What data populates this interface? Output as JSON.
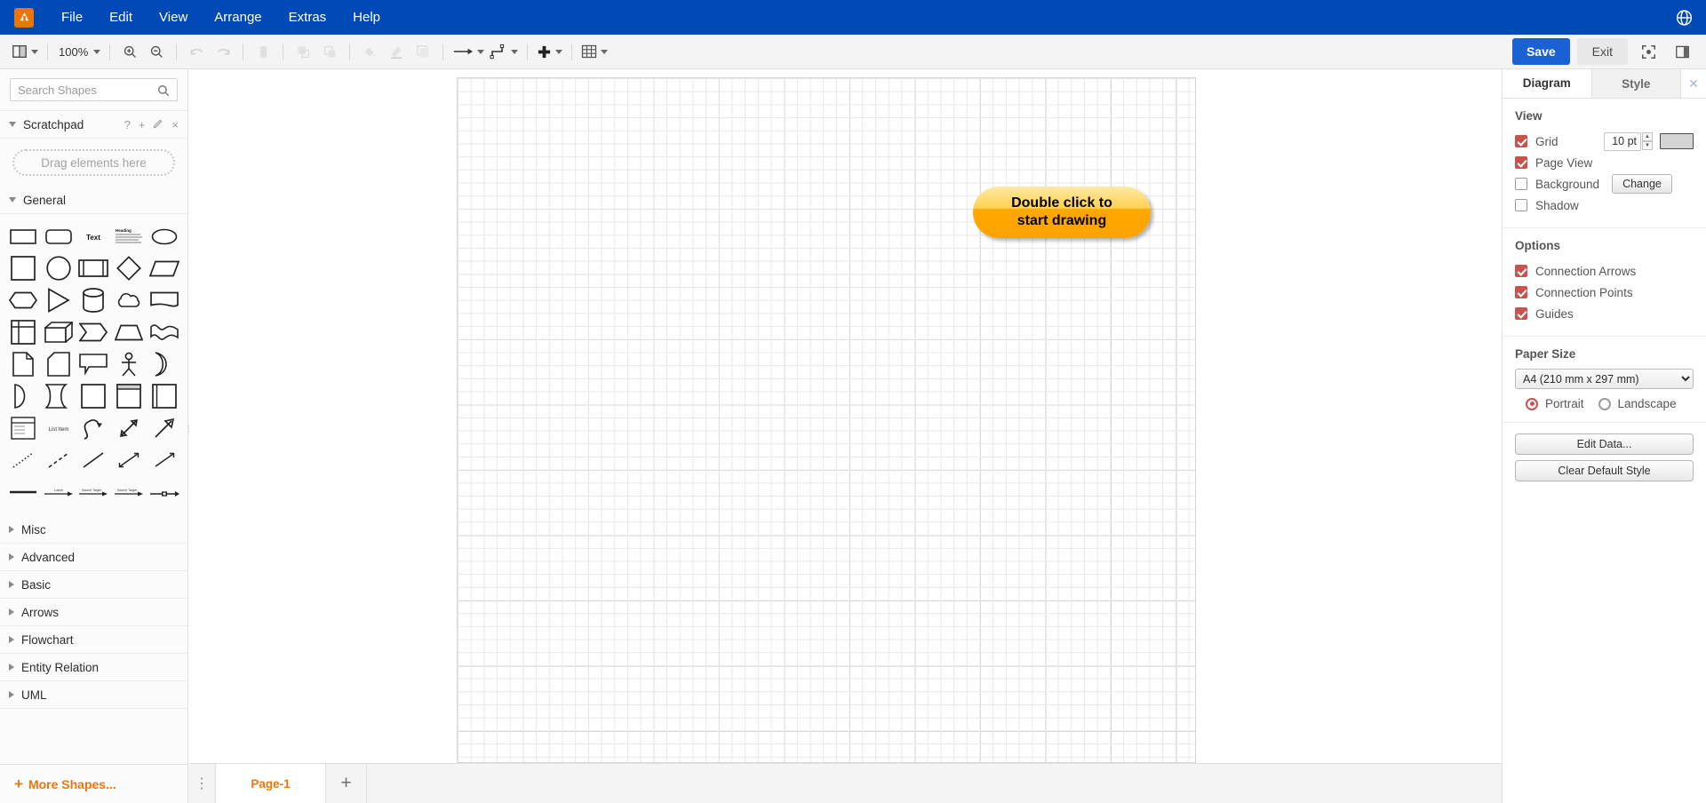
{
  "menubar": {
    "logo_icon": "drawio-logo-icon",
    "items": [
      "File",
      "Edit",
      "View",
      "Arrange",
      "Extras",
      "Help"
    ],
    "language_icon": "globe-icon"
  },
  "toolbar": {
    "view_icon": "panel-layout-icon",
    "zoom_label": "100%",
    "zoom_in_icon": "zoom-in-icon",
    "zoom_out_icon": "zoom-out-icon",
    "undo_icon": "undo-icon",
    "redo_icon": "redo-icon",
    "delete_icon": "trash-icon",
    "to_front_icon": "bring-to-front-icon",
    "to_back_icon": "send-to-back-icon",
    "fill_icon": "fill-color-icon",
    "line_icon": "line-color-icon",
    "shadow_icon": "shadow-icon",
    "waypoints_icon": "connection-arrow-icon",
    "edge_style_icon": "edge-style-icon",
    "insert_icon": "plus-icon",
    "table_icon": "table-icon",
    "save_label": "Save",
    "exit_label": "Exit",
    "fullscreen_icon": "fullscreen-icon",
    "format_panel_icon": "format-panel-icon"
  },
  "sidebar": {
    "search": {
      "placeholder": "Search Shapes",
      "value": "",
      "icon": "search-icon"
    },
    "scratchpad": {
      "label": "Scratchpad",
      "help_icon": "?",
      "add_icon": "+",
      "edit_icon": "edit-pencil-icon",
      "close_icon": "×",
      "dropzone_label": "Drag elements here"
    },
    "general": {
      "label": "General",
      "shapes": [
        "rectangle",
        "rounded-rectangle",
        "text",
        "textbox",
        "ellipse",
        "square",
        "circle",
        "process",
        "diamond",
        "parallelogram",
        "hexagon",
        "triangle",
        "cylinder",
        "cloud",
        "document",
        "internal-storage",
        "cube",
        "step",
        "trapezoid",
        "tape",
        "note",
        "card",
        "callout",
        "actor",
        "or-shape",
        "and-shape",
        "data-storage",
        "container",
        "vertical-container",
        "horizontal-container",
        "list",
        "list-item",
        "curve",
        "bidirectional-arrow",
        "directional-arrow",
        "dotted-line",
        "dashed-line",
        "line",
        "bidirectional-connector",
        "directional-connector",
        "link",
        "arrow-label-edge",
        "edge-with-label",
        "edge-two-labels",
        "edge-midpoint-label"
      ]
    },
    "categories": [
      "Misc",
      "Advanced",
      "Basic",
      "Arrows",
      "Flowchart",
      "Entity Relation",
      "UML"
    ],
    "more_shapes_label": "More Shapes...",
    "more_shapes_icon": "plus-icon",
    "accent_color": "#e8780c"
  },
  "canvas": {
    "start_shape_label": "Double click to\nstart drawing",
    "start_shape_line1": "Double click to",
    "start_shape_line2": "start drawing",
    "shape_fill_color": "#ffa800",
    "collapse_handle_icon": "collapse-handle-icon"
  },
  "tabbar": {
    "menu_icon": "vertical-dots-icon",
    "pages": [
      "Page-1"
    ],
    "add_page_icon": "plus-icon"
  },
  "format_panel": {
    "tabs": [
      "Diagram",
      "Style"
    ],
    "active_tab": "Diagram",
    "close_icon": "close-icon",
    "view": {
      "title": "View",
      "grid": {
        "label": "Grid",
        "checked": true,
        "size_value": "10 pt",
        "color": "#d4d4d4"
      },
      "page_view": {
        "label": "Page View",
        "checked": true
      },
      "background": {
        "label": "Background",
        "checked": false,
        "button_label": "Change"
      },
      "shadow": {
        "label": "Shadow",
        "checked": false
      }
    },
    "options": {
      "title": "Options",
      "items": [
        {
          "label": "Connection Arrows",
          "checked": true
        },
        {
          "label": "Connection Points",
          "checked": true
        },
        {
          "label": "Guides",
          "checked": true
        }
      ]
    },
    "paper": {
      "title": "Paper Size",
      "selected": "A4 (210 mm x 297 mm)",
      "orientation": {
        "portrait": "Portrait",
        "landscape": "Landscape",
        "selected": "Portrait"
      }
    },
    "actions": [
      "Edit Data...",
      "Clear Default Style"
    ]
  }
}
